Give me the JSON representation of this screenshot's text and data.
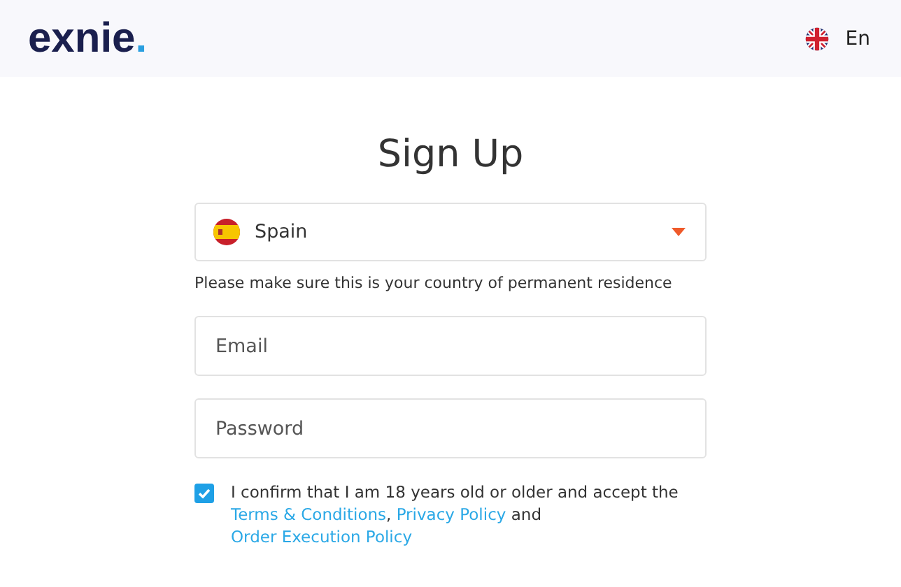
{
  "header": {
    "logo": {
      "text": "exnie",
      "mark": "."
    },
    "language": {
      "label": "En"
    }
  },
  "title": "Sign Up",
  "country": {
    "value": "Spain"
  },
  "country_hint": "Please make sure this is your country of permanent residence",
  "fields": [
    {
      "placeholder": "Email"
    },
    {
      "placeholder": "Password"
    }
  ],
  "consent": {
    "checked": true,
    "parts": [
      {
        "kind": "text",
        "text": "I confirm that I am 18 years old or older and accept the "
      },
      {
        "kind": "link",
        "text": "Terms & Conditions"
      },
      {
        "kind": "text",
        "text": ", "
      },
      {
        "kind": "link",
        "text": "Privacy Policy"
      },
      {
        "kind": "text",
        "text": " and "
      },
      {
        "kind": "link",
        "text": "Order Execution Policy"
      }
    ]
  }
}
